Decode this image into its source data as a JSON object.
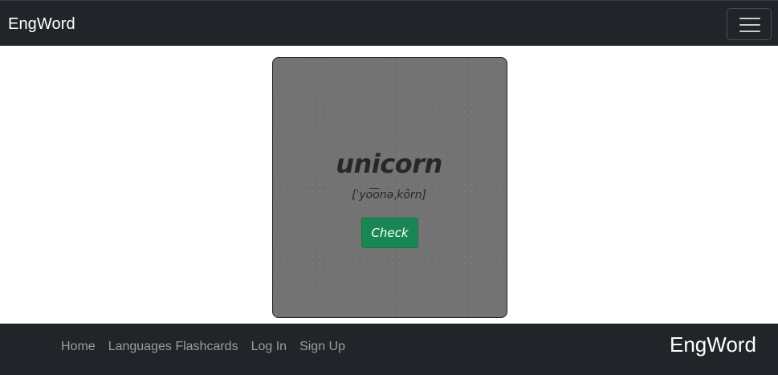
{
  "navbar": {
    "brand": "EngWord",
    "toggler_icon": "hamburger-menu-icon"
  },
  "flashcard": {
    "word": "unicorn",
    "pronunciation": "[ˈyo͞onəˌkôrn]",
    "check_label": "Check"
  },
  "footer": {
    "links": [
      "Home",
      "Languages Flashcards",
      "Log In",
      "Sign Up"
    ],
    "brand": "EngWord"
  },
  "colors": {
    "navbar_bg": "#212529",
    "card_bg": "#737373",
    "check_button": "#198754",
    "footer_link": "#9a9da0"
  }
}
